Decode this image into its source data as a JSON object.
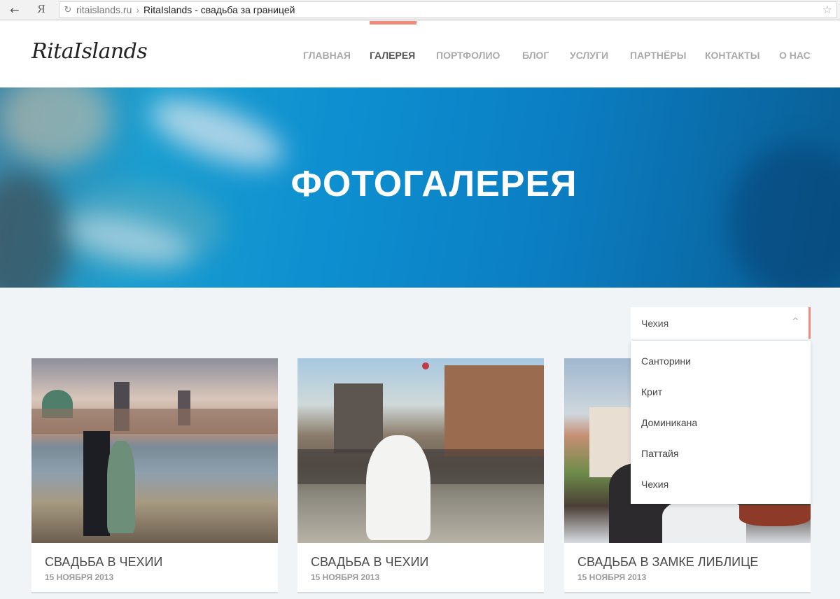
{
  "browser": {
    "back_icon": "arrow-left-icon",
    "yandex_label": "Я",
    "reload_icon": "reload-icon",
    "domain": "ritaislands.ru",
    "separator": "›",
    "page_title": "RitaIslands - свадьба за границей",
    "bookmark_icon": "star-icon"
  },
  "header": {
    "logo": "RitaIslands",
    "nav": [
      {
        "label": "ГЛАВНАЯ",
        "active": false
      },
      {
        "label": "ГАЛЕРЕЯ",
        "active": true
      },
      {
        "label": "ПОРТФОЛИО",
        "active": false
      },
      {
        "label": "БЛОГ",
        "active": false
      },
      {
        "label": "УСЛУГИ",
        "active": false
      },
      {
        "label": "ПАРТНЁРЫ",
        "active": false
      },
      {
        "label": "КОНТАКТЫ",
        "active": false
      },
      {
        "label": "О НАС",
        "active": false
      }
    ],
    "accent_color": "#f18a7a"
  },
  "hero": {
    "title": "ФОТОГАЛЕРЕЯ"
  },
  "filter": {
    "selected": "Чехия",
    "options": [
      "Санторини",
      "Крит",
      "Доминикана",
      "Паттайя",
      "Чехия"
    ]
  },
  "cards": [
    {
      "title": "СВАДЬБА В ЧЕХИИ",
      "date": "15 НОЯБРЯ 2013"
    },
    {
      "title": "СВАДЬБА В ЧЕХИИ",
      "date": "15 НОЯБРЯ 2013"
    },
    {
      "title": "СВАДЬБА В ЗАМКЕ ЛИБЛИЦЕ",
      "date": "15 НОЯБРЯ 2013"
    }
  ]
}
